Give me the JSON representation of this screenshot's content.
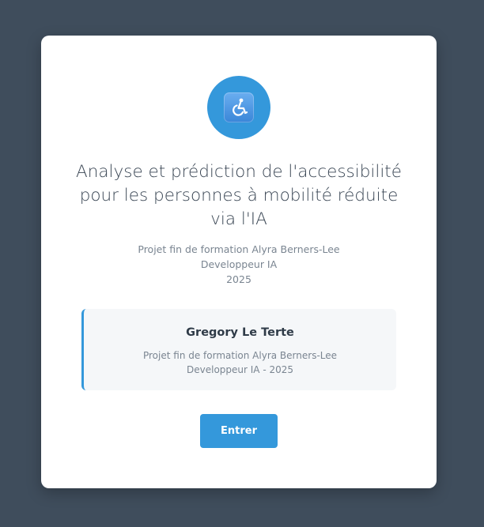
{
  "colors": {
    "background": "#3f4d5c",
    "card": "#ffffff",
    "accent": "#3498db"
  },
  "logo": {
    "icon": "wheelchair-icon"
  },
  "title": {
    "line1": "Analyse et prédiction de l'accessibilité",
    "line2": "pour les personnes à mobilité réduite",
    "line3": "via l'IA"
  },
  "subtitle": {
    "line1": "Projet fin de formation Alyra Berners-Lee",
    "line2": "Developpeur IA",
    "line3": "2025"
  },
  "author": {
    "name": "Gregory Le Terte",
    "line1": "Projet fin de formation Alyra Berners-Lee",
    "line2": "Developpeur IA - 2025"
  },
  "enter_button": {
    "label": "Entrer"
  }
}
